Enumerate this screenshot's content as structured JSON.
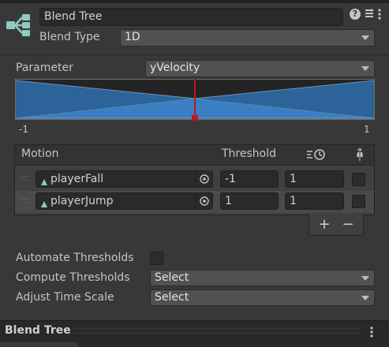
{
  "header": {
    "name_value": "Blend Tree",
    "blend_type_label": "Blend Type",
    "blend_type_value": "1D"
  },
  "parameter": {
    "label": "Parameter",
    "value": "yVelocity"
  },
  "graph": {
    "min_label": "-1",
    "max_label": "1"
  },
  "motion_table": {
    "col_motion": "Motion",
    "col_threshold": "Threshold",
    "rows": [
      {
        "motion": "playerFall",
        "threshold": "-1",
        "time_scale": "1"
      },
      {
        "motion": "playerJump",
        "threshold": "1",
        "time_scale": "1"
      }
    ],
    "add_label": "+",
    "remove_label": "−"
  },
  "options": {
    "automate_label": "Automate Thresholds",
    "compute_label": "Compute Thresholds",
    "compute_value": "Select",
    "adjust_label": "Adjust Time Scale",
    "adjust_value": "Select"
  },
  "footer": {
    "title": "Blend Tree"
  },
  "colors": {
    "accent_blue": "#2f6ea6",
    "marker_red": "#c0181c"
  }
}
